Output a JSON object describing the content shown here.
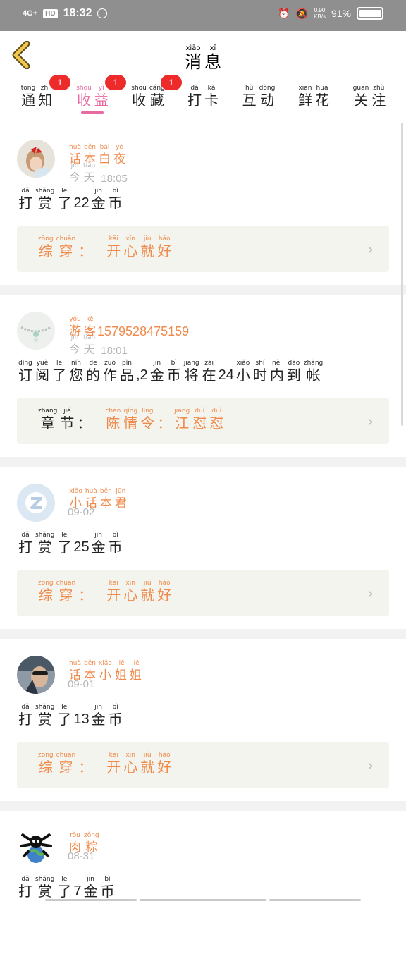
{
  "status_bar": {
    "network": "4G+",
    "hd": "HD",
    "time": "18:32",
    "speed_value": "0.90",
    "speed_unit": "KB/s",
    "battery": "91%",
    "battery_level": 0.91
  },
  "header": {
    "title": [
      {
        "py": "xiāo",
        "hz": "消"
      },
      {
        "py": "xī",
        "hz": "息"
      }
    ]
  },
  "tabs": [
    {
      "chars": [
        {
          "py": "tōng",
          "hz": "通"
        },
        {
          "py": "zhī",
          "hz": "知"
        }
      ],
      "badge": "1",
      "active": false
    },
    {
      "chars": [
        {
          "py": "shōu",
          "hz": "收"
        },
        {
          "py": "yì",
          "hz": "益"
        }
      ],
      "badge": "1",
      "active": true
    },
    {
      "chars": [
        {
          "py": "shōu",
          "hz": "收"
        },
        {
          "py": "cáng",
          "hz": "藏"
        }
      ],
      "badge": "1",
      "active": false
    },
    {
      "chars": [
        {
          "py": "dǎ",
          "hz": "打"
        },
        {
          "py": "kǎ",
          "hz": "卡"
        }
      ],
      "badge": "",
      "active": false
    },
    {
      "chars": [
        {
          "py": "hù",
          "hz": "互"
        },
        {
          "py": "dòng",
          "hz": "动"
        }
      ],
      "badge": "",
      "active": false
    },
    {
      "chars": [
        {
          "py": "xiān",
          "hz": "鲜"
        },
        {
          "py": "huā",
          "hz": "花"
        }
      ],
      "badge": "",
      "active": false
    },
    {
      "chars": [
        {
          "py": "guān",
          "hz": "关"
        },
        {
          "py": "zhù",
          "hz": "注"
        }
      ],
      "badge": "",
      "active": false
    }
  ],
  "messages": [
    {
      "avatar": "girl-red-bow-avatar",
      "name": [
        {
          "py": "huà",
          "hz": "话"
        },
        {
          "py": "běn",
          "hz": "本"
        },
        {
          "py": "bái",
          "hz": "白"
        },
        {
          "py": "yè",
          "hz": "夜"
        }
      ],
      "name_suffix": "",
      "time_chars": [
        {
          "py": "jīn",
          "hz": "今"
        },
        {
          "py": "tiān",
          "hz": "天"
        }
      ],
      "time": "18:05",
      "text": [
        {
          "py": "dǎ",
          "hz": "打"
        },
        {
          "py": "shǎng",
          "hz": "赏"
        },
        {
          "py": "le",
          "hz": "了"
        },
        {
          "num": "22"
        },
        {
          "py": "jīn",
          "hz": "金"
        },
        {
          "py": "bì",
          "hz": "币"
        }
      ],
      "quote_label": [
        {
          "py": "zōng",
          "hz": "综"
        },
        {
          "py": "chuān",
          "hz": "穿"
        },
        {
          "p": "："
        }
      ],
      "quote_value": [
        {
          "py": "kāi",
          "hz": "开"
        },
        {
          "py": "xīn",
          "hz": "心"
        },
        {
          "py": "jiù",
          "hz": "就"
        },
        {
          "py": "hǎo",
          "hz": "好"
        }
      ],
      "quote_dark": false
    },
    {
      "avatar": "bracelet-avatar",
      "name": [
        {
          "py": "yóu",
          "hz": "游"
        },
        {
          "py": "kè",
          "hz": "客"
        }
      ],
      "name_suffix": "15795284751​59",
      "time_chars": [
        {
          "py": "jīn",
          "hz": "今"
        },
        {
          "py": "tiān",
          "hz": "天"
        }
      ],
      "time": "18:01",
      "text": [
        {
          "py": "dìng",
          "hz": "订"
        },
        {
          "py": "yuè",
          "hz": "阅"
        },
        {
          "py": "le",
          "hz": "了"
        },
        {
          "py": "nín",
          "hz": "您"
        },
        {
          "py": "de",
          "hz": "的"
        },
        {
          "py": "zuò",
          "hz": "作"
        },
        {
          "py": "pǐn",
          "hz": "品"
        },
        {
          "num": ",2"
        },
        {
          "py": "jīn",
          "hz": "金"
        },
        {
          "py": "bì",
          "hz": "币"
        },
        {
          "py": "jiāng",
          "hz": "将"
        },
        {
          "py": "zài",
          "hz": "在"
        },
        {
          "num": "24"
        },
        {
          "py": "xiǎo",
          "hz": "小"
        },
        {
          "py": "shí",
          "hz": "时"
        },
        {
          "py": "nèi",
          "hz": "内"
        },
        {
          "py": "dào",
          "hz": "到"
        },
        {
          "py": "zhàng",
          "hz": "帐"
        }
      ],
      "quote_label": [
        {
          "py": "zhāng",
          "hz": "章"
        },
        {
          "py": "jié",
          "hz": "节"
        },
        {
          "p": "："
        }
      ],
      "quote_value": [
        {
          "py": "chén",
          "hz": "陈"
        },
        {
          "py": "qíng",
          "hz": "情"
        },
        {
          "py": "lìng",
          "hz": "令"
        },
        {
          "p": "："
        },
        {
          "py": "jiāng",
          "hz": "江"
        },
        {
          "py": "duì",
          "hz": "怼"
        },
        {
          "py": "duì",
          "hz": "怼"
        }
      ],
      "quote_dark": true
    },
    {
      "avatar": "default-z-avatar",
      "name": [
        {
          "py": "xiǎo",
          "hz": "小"
        },
        {
          "py": "huà",
          "hz": "话"
        },
        {
          "py": "běn",
          "hz": "本"
        },
        {
          "py": "jūn",
          "hz": "君"
        }
      ],
      "name_suffix": "",
      "time_chars": [],
      "time": "09-02",
      "text": [
        {
          "py": "dǎ",
          "hz": "打"
        },
        {
          "py": "shǎng",
          "hz": "赏"
        },
        {
          "py": "le",
          "hz": "了"
        },
        {
          "num": "25"
        },
        {
          "py": "jīn",
          "hz": "金"
        },
        {
          "py": "bì",
          "hz": "币"
        }
      ],
      "quote_label": [
        {
          "py": "zōng",
          "hz": "综"
        },
        {
          "py": "chuān",
          "hz": "穿"
        },
        {
          "p": "："
        }
      ],
      "quote_value": [
        {
          "py": "kāi",
          "hz": "开"
        },
        {
          "py": "xīn",
          "hz": "心"
        },
        {
          "py": "jiù",
          "hz": "就"
        },
        {
          "py": "hǎo",
          "hz": "好"
        }
      ],
      "quote_dark": false
    },
    {
      "avatar": "person-sunglasses-avatar",
      "name": [
        {
          "py": "huà",
          "hz": "话"
        },
        {
          "py": "běn",
          "hz": "本"
        },
        {
          "py": "xiǎo",
          "hz": "小"
        },
        {
          "py": "jiě",
          "hz": "姐"
        },
        {
          "py": "jiě",
          "hz": "姐"
        }
      ],
      "name_suffix": "",
      "time_chars": [],
      "time": "09-01",
      "text": [
        {
          "py": "dǎ",
          "hz": "打"
        },
        {
          "py": "shǎng",
          "hz": "赏"
        },
        {
          "py": "le",
          "hz": "了"
        },
        {
          "num": "13"
        },
        {
          "py": "jīn",
          "hz": "金"
        },
        {
          "py": "bì",
          "hz": "币"
        }
      ],
      "quote_label": [
        {
          "py": "zōng",
          "hz": "综"
        },
        {
          "py": "chuān",
          "hz": "穿"
        },
        {
          "p": "："
        }
      ],
      "quote_value": [
        {
          "py": "kāi",
          "hz": "开"
        },
        {
          "py": "xīn",
          "hz": "心"
        },
        {
          "py": "jiù",
          "hz": "就"
        },
        {
          "py": "hǎo",
          "hz": "好"
        }
      ],
      "quote_dark": false
    },
    {
      "avatar": "skull-globe-avatar",
      "name": [
        {
          "py": "ròu",
          "hz": "肉"
        },
        {
          "py": "zòng",
          "hz": "粽"
        }
      ],
      "name_suffix": "",
      "time_chars": [],
      "time": "08-31",
      "text": [
        {
          "py": "dǎ",
          "hz": "打"
        },
        {
          "py": "shǎng",
          "hz": "赏"
        },
        {
          "py": "le",
          "hz": "了"
        },
        {
          "num": "7"
        },
        {
          "py": "jīn",
          "hz": "金"
        },
        {
          "py": "bì",
          "hz": "币"
        }
      ],
      "quote_label": [],
      "quote_value": [],
      "quote_dark": false
    }
  ]
}
